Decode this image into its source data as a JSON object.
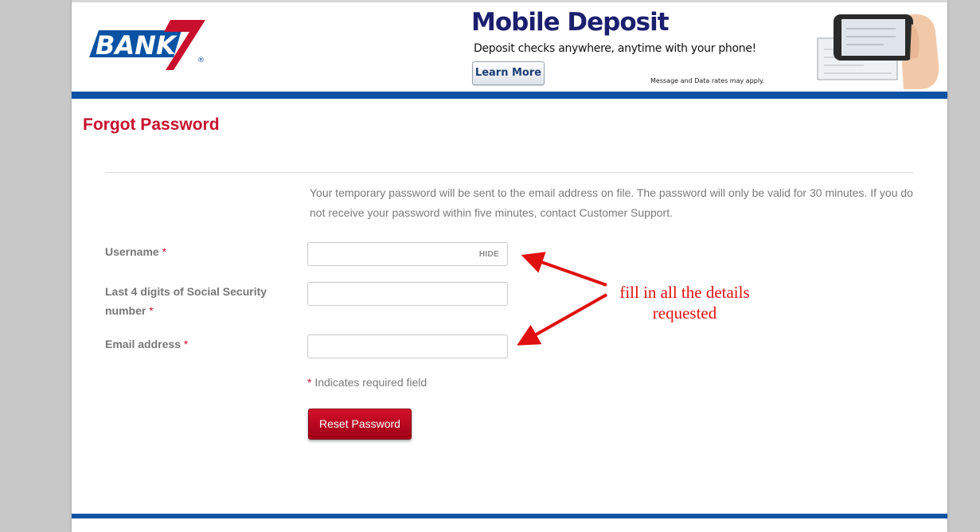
{
  "brand": {
    "logo_text": "BANK",
    "registered_mark": "®",
    "primary_blue": "#0a52a4",
    "accent_red": "#c8102e"
  },
  "banner": {
    "title": "Mobile Deposit",
    "subtitle": "Deposit checks anywhere, anytime with your phone!",
    "learn_more_label": "Learn More",
    "note": "Message and Data rates may apply."
  },
  "page": {
    "title": "Forgot Password",
    "info": "Your temporary password will be sent to the email address on file. The password will only be valid for 30 minutes. If you do not receive your password within five minutes, contact Customer Support."
  },
  "form": {
    "username": {
      "label": "Username",
      "required_mark": "*",
      "value": "",
      "toggle_label": "HIDE"
    },
    "ssn": {
      "label": "Last 4 digits of Social Security number",
      "required_mark": "*",
      "value": ""
    },
    "email": {
      "label": "Email address",
      "required_mark": "*",
      "value": ""
    },
    "required_note_mark": "*",
    "required_note": " Indicates required field",
    "submit_label": "Reset Password"
  },
  "annotation": {
    "line1": "fill in all the details",
    "line2": "requested",
    "color": "#e01010"
  }
}
